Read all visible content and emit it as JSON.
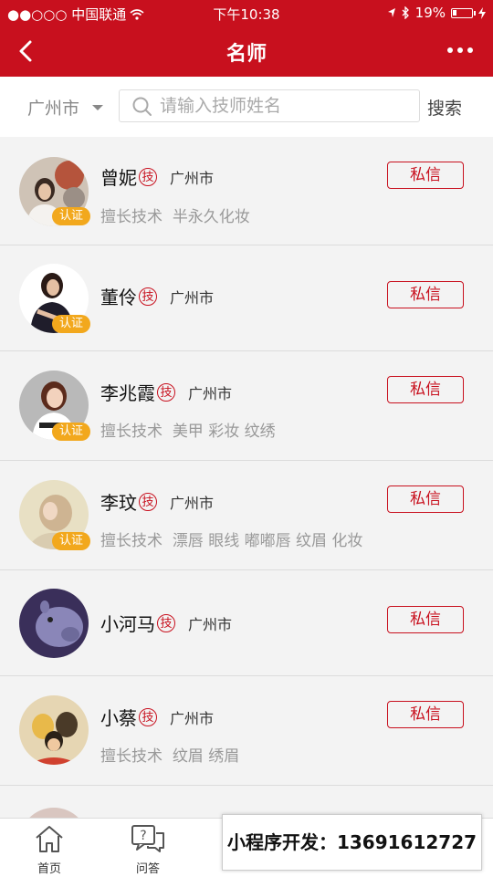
{
  "status_bar": {
    "carrier": "●●○○○ 中国联通",
    "time": "下午10:38",
    "battery": "19%",
    "battery_level": 0.19
  },
  "nav": {
    "title": "名师"
  },
  "search": {
    "city": "广州市",
    "placeholder": "请输入技师姓名",
    "value": "",
    "button": "搜索"
  },
  "masters": [
    {
      "name": "曾妮",
      "badge": "技",
      "city": "广州市",
      "certified": "认证",
      "skills_label": "擅长技术",
      "skills": "半永久化妆",
      "message": "私信"
    },
    {
      "name": "董伶",
      "badge": "技",
      "city": "广州市",
      "certified": "认证",
      "skills_label": "",
      "skills": "",
      "message": "私信"
    },
    {
      "name": "李兆霞",
      "badge": "技",
      "city": "广州市",
      "certified": "认证",
      "skills_label": "擅长技术",
      "skills": "美甲  彩妆  纹绣",
      "message": "私信"
    },
    {
      "name": "李玟",
      "badge": "技",
      "city": "广州市",
      "certified": "认证",
      "skills_label": "擅长技术",
      "skills": "漂唇  眼线  嘟嘟唇  纹眉  化妆",
      "message": "私信"
    },
    {
      "name": "小河马",
      "badge": "技",
      "city": "广州市",
      "certified": "",
      "skills_label": "",
      "skills": "",
      "message": "私信"
    },
    {
      "name": "小蔡",
      "badge": "技",
      "city": "广州市",
      "certified": "",
      "skills_label": "擅长技术",
      "skills": "纹眉  绣眉",
      "message": "私信"
    }
  ],
  "tabs": [
    {
      "label": "首页",
      "icon": "home-icon"
    },
    {
      "label": "问答",
      "icon": "qa-icon"
    }
  ],
  "promo": {
    "text": "小程序开发：13691612727"
  },
  "colors": {
    "brand": "#c8101e",
    "cert_badge": "#f2a81d"
  }
}
